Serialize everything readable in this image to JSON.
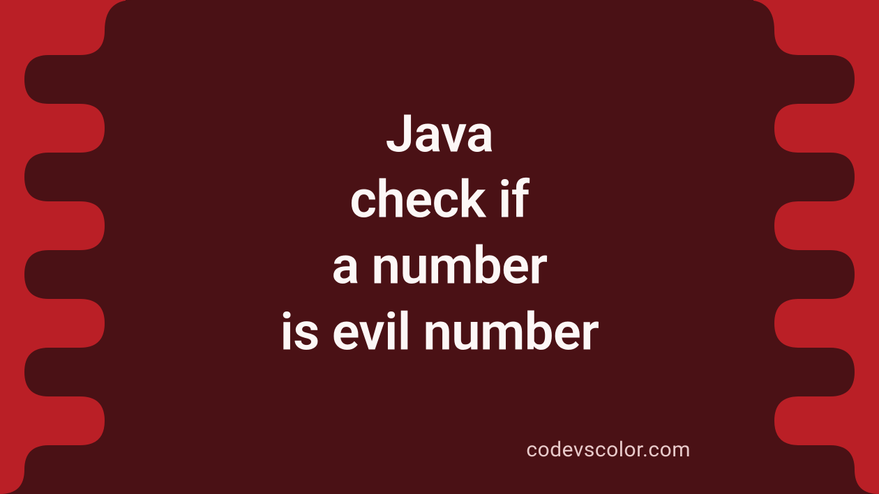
{
  "title": {
    "line1": "Java",
    "line2": "check if",
    "line3": "a number",
    "line4": "is evil number"
  },
  "footer": "codevscolor.com",
  "colors": {
    "background": "#BA1F26",
    "panel": "#4A1115",
    "text": "#FCF7F6",
    "footer": "#E8CACA"
  }
}
